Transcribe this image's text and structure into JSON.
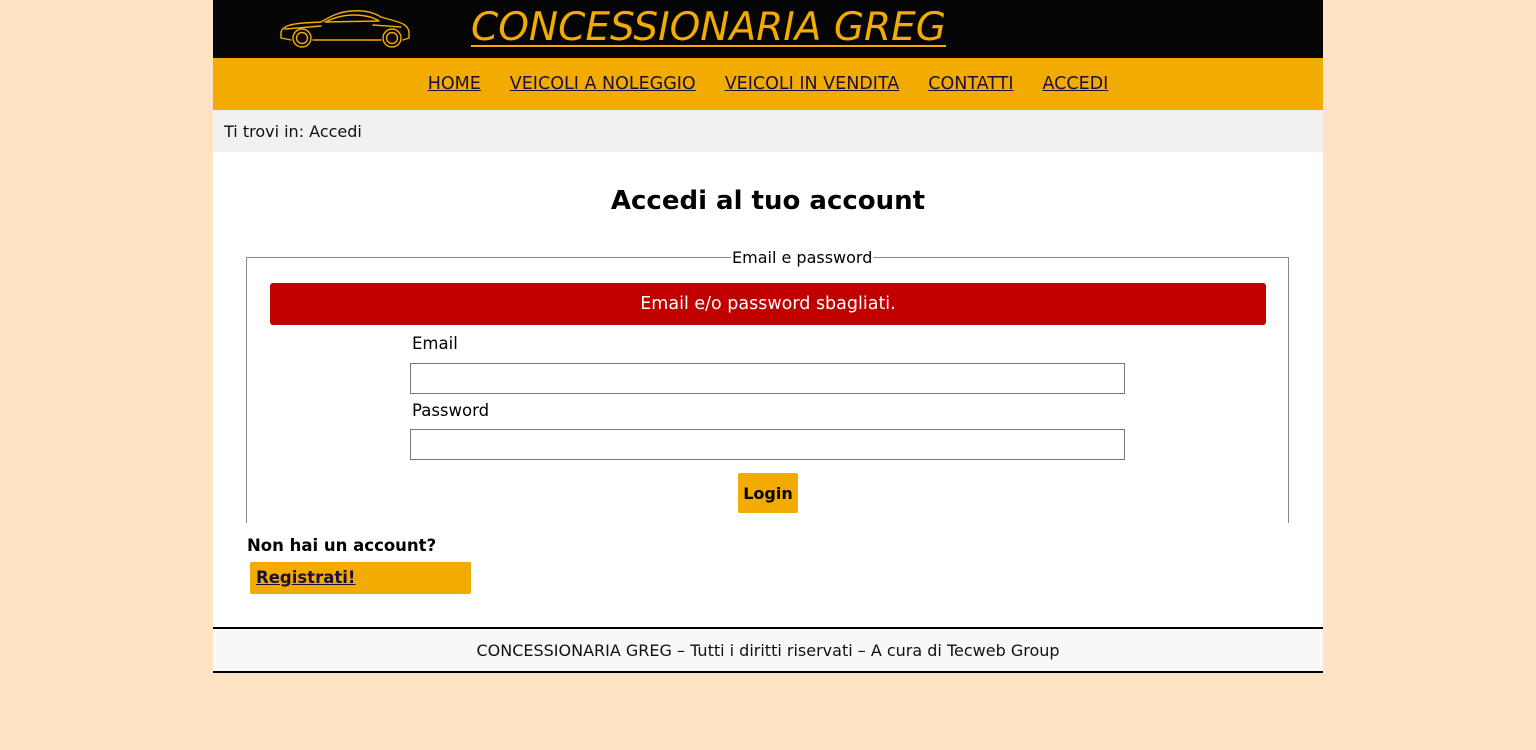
{
  "header": {
    "logo_icon": "sports-car-icon",
    "site_title": "CONCESSIONARIA GREG"
  },
  "nav": {
    "items": [
      {
        "label": "HOME"
      },
      {
        "label": "VEICOLI A NOLEGGIO"
      },
      {
        "label": "VEICOLI IN VENDITA"
      },
      {
        "label": "CONTATTI"
      },
      {
        "label": "ACCEDI"
      }
    ]
  },
  "breadcrumb": {
    "text": "Ti trovi in: Accedi"
  },
  "main": {
    "title": "Accedi al tuo account",
    "form": {
      "legend": "Email e password",
      "error": "Email e/o password sbagliati.",
      "email_label": "Email",
      "email_value": "",
      "password_label": "Password",
      "password_value": "",
      "submit_label": "Login"
    },
    "no_account_text": "Non hai un account?",
    "register_label": "Registrati!"
  },
  "footer": {
    "text": "CONCESSIONARIA GREG – Tutti i diritti riservati – A cura di Tecweb Group"
  },
  "colors": {
    "page_background": "#fee4c3",
    "header_background": "#050505",
    "accent": "#f2ab00",
    "error": "#c10000",
    "link": "#1a1039",
    "breadcrumb_background": "#f1f1f1"
  }
}
